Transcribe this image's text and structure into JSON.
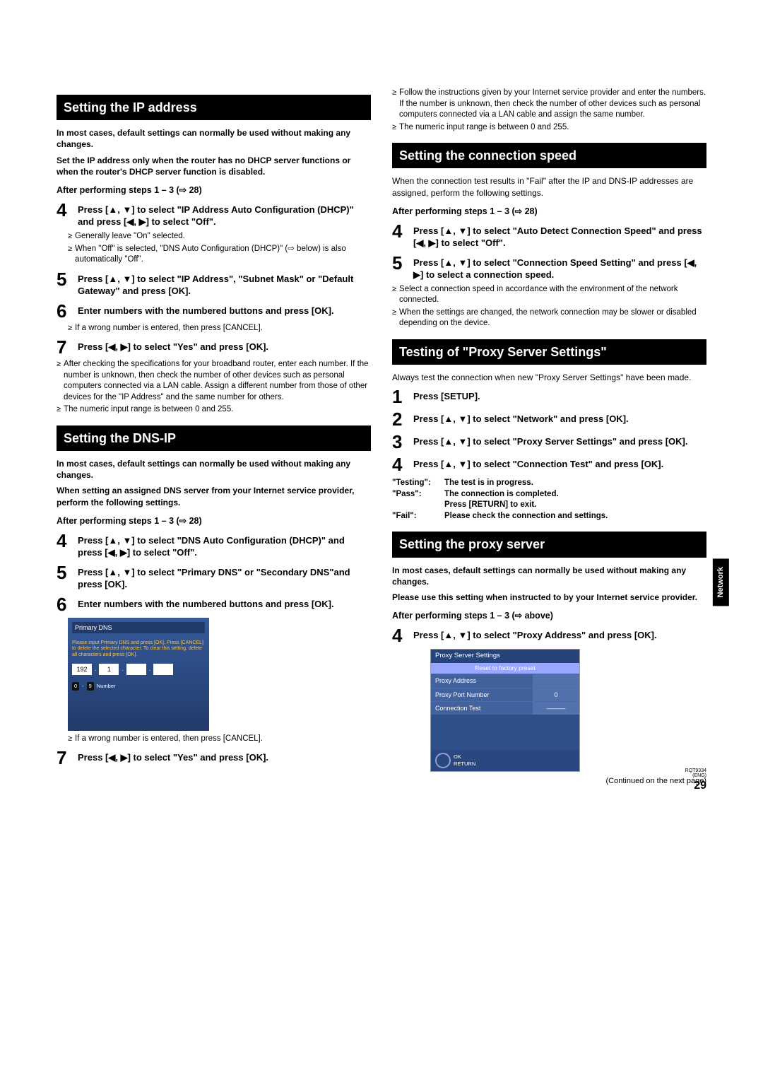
{
  "page_number": "29",
  "footer_code1": "RQT9334",
  "footer_code2": "(ENG)",
  "side_tab": "Network",
  "continued": "(Continued on the next page)",
  "col1": {
    "sec1_title": "Setting the IP address",
    "sec1_intro1": "In most cases, default settings can normally be used without making any changes.",
    "sec1_intro2": "Set the IP address only when the router has no DHCP server functions or when the router's DHCP server function is disabled.",
    "sec1_after": "After performing steps 1 – 3 (⇨ 28)",
    "s4": "Press [▲, ▼] to select \"IP Address Auto Configuration (DHCP)\" and press [◀, ▶] to select \"Off\".",
    "s4_b1": "Generally leave \"On\" selected.",
    "s4_b2": "When \"Off\" is selected, \"DNS Auto Configuration (DHCP)\" (⇨ below) is also automatically \"Off\".",
    "s5": "Press [▲, ▼] to select \"IP Address\", \"Subnet Mask\" or \"Default Gateway\" and press [OK].",
    "s6": "Enter numbers with the numbered buttons and press [OK].",
    "s6_b1": "If a wrong number is entered, then press [CANCEL].",
    "s7": "Press [◀, ▶] to select \"Yes\" and press [OK].",
    "sec1_notes_b1": "After checking the specifications for your broadband router, enter each number. If the number is unknown, then check the number of other devices such as personal computers connected via a LAN cable. Assign a different number from those of other devices for the \"IP Address\" and the same number for others.",
    "sec1_notes_b2": "The numeric input range is between 0 and 255.",
    "sec2_title": "Setting the DNS-IP",
    "sec2_intro1": "In most cases, default settings can normally be used without making any changes.",
    "sec2_intro2": "When setting an assigned DNS server from your Internet service provider, perform the following settings.",
    "sec2_after": "After performing steps 1 – 3 (⇨ 28)",
    "d4": "Press [▲, ▼] to select \"DNS Auto Configuration (DHCP)\" and press [◀, ▶] to select \"Off\".",
    "d5": "Press [▲, ▼] to select \"Primary DNS\" or \"Secondary DNS\"and press [OK].",
    "d6": "Enter numbers with the numbered buttons and press [OK].",
    "fig_dns_title": "Primary DNS",
    "fig_dns_msg": "Please input Primary DNS and press [OK]. Press [CANCEL] to delete the selected character. To clear this setting, delete all characters and press [OK].",
    "fig_dns_ip1": "192",
    "fig_dns_ip2": "1",
    "fig_dns_legend": "Number",
    "d6_b1": "If a wrong number is entered, then press [CANCEL].",
    "d7": "Press [◀, ▶] to select \"Yes\" and press [OK]."
  },
  "col2": {
    "top_b1": "Follow the instructions given by your Internet service provider and enter the numbers. If the number is unknown, then check the number of other devices such as personal computers connected via a LAN cable and assign the same number.",
    "top_b2": "The numeric input range is between 0 and 255.",
    "sec3_title": "Setting the connection speed",
    "sec3_intro": "When the connection test results in \"Fail\" after the IP and DNS-IP addresses are assigned, perform the following settings.",
    "sec3_after": "After performing steps 1 – 3 (⇨ 28)",
    "c4": "Press [▲, ▼] to select \"Auto Detect Connection Speed\" and press [◀, ▶] to select \"Off\".",
    "c5": "Press [▲, ▼] to select \"Connection Speed Setting\" and press [◀, ▶] to select a connection speed.",
    "c_b1": "Select a connection speed in accordance with the environment of the network connected.",
    "c_b2": "When the settings are changed, the network connection may be slower or disabled depending on the device.",
    "sec4_title": "Testing of \"Proxy Server Settings\"",
    "sec4_intro": "Always test the connection when new \"Proxy Server Settings\" have been made.",
    "t1": "Press [SETUP].",
    "t2": "Press [▲, ▼] to select \"Network\" and press [OK].",
    "t3": "Press [▲, ▼] to select \"Proxy Server Settings\" and press [OK].",
    "t4": "Press [▲, ▼] to select \"Connection Test\" and press [OK].",
    "status": {
      "testing_k": "\"Testing\":",
      "testing_v": "The test is in progress.",
      "pass_k": "\"Pass\":",
      "pass_v1": "The connection is completed.",
      "pass_v2": "Press [RETURN] to exit.",
      "fail_k": "\"Fail\":",
      "fail_v": "Please check the connection and settings."
    },
    "sec5_title": "Setting the proxy server",
    "sec5_intro1": "In most cases, default settings can normally be used without making any changes.",
    "sec5_intro2": "Please use this setting when instructed to by your Internet service provider.",
    "sec5_after": "After performing steps 1 – 3 (⇨ above)",
    "p4": "Press [▲, ▼] to select \"Proxy Address\" and press [OK].",
    "fig_proxy_head": "Proxy Server Settings",
    "fig_proxy_reset": "Reset to factory preset",
    "fig_proxy_r1": "Proxy Address",
    "fig_proxy_r2": "Proxy Port Number",
    "fig_proxy_r2v": "0",
    "fig_proxy_r3": "Connection Test",
    "fig_proxy_ok": "OK",
    "fig_proxy_ret": "RETURN"
  }
}
